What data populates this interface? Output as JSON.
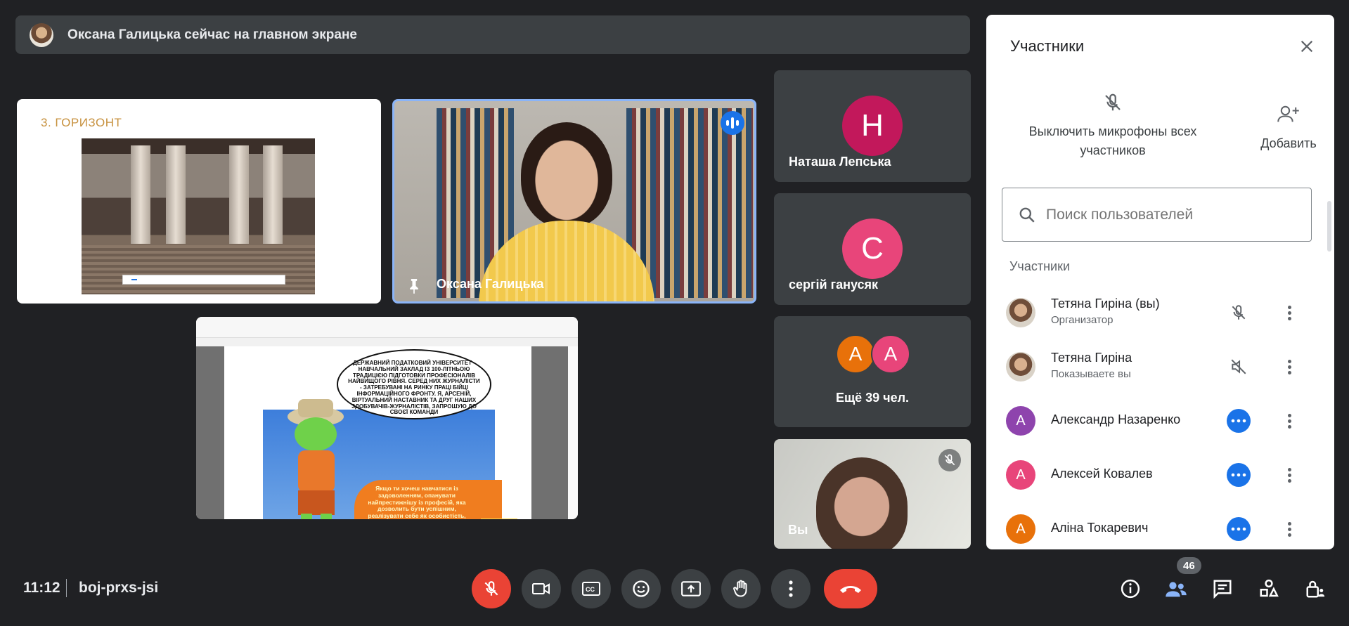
{
  "banner": {
    "text": "Оксана Галицька сейчас на главном экране"
  },
  "tiles": {
    "slide": {
      "title": "3. ГОРИЗОНТ",
      "bar_text": "",
      "bar_button": ""
    },
    "speaker": {
      "name": "Оксана Галицька"
    },
    "document": {
      "bubble_text": "ДЕРЖАВНИЙ ПОДАТКОВИЙ УНІВЕРСИТЕТ - НАВЧАЛЬНИЙ ЗАКЛАД ІЗ 100-ЛІТНЬОЮ ТРАДИЦІЄЮ ПІДГОТОВКИ ПРОФЕСІОНАЛІВ НАЙВИЩОГО РІВНЯ. СЕРЕД НИХ ЖУРНАЛІСТИ - ЗАТРЕБУВАНІ НА РИНКУ ПРАЦІ БІЙЦІ ІНФОРМАЦІЙНОГО ФРОНТУ. Я, АРСЕНІЙ, ВІРТУАЛЬНИЙ НАСТАВНИК ТА ДРУГ НАШИХ ЗДОБУВАЧІВ-ЖУРНАЛІСТІВ, ЗАПРОШУЮ ДО СВОЄЇ КОМАНДИ",
      "orange_text": "Якщо ти хочеш навчатися із задоволенням, опанувати найпрестижнішу із професій, яка дозволить бути успішним, реалізувати себе як особистість, заробляти і залишатися вільним, мобільним, фінансово незалежним - тобі до нашої команди!"
    },
    "participants": [
      {
        "name": "Наташа Лепська",
        "initial": "Н",
        "color": "#c2185b"
      },
      {
        "name": "сергій ганусяк",
        "initial": "С",
        "color": "#e8457a"
      }
    ],
    "more": {
      "label": "Ещё 39 чел.",
      "initials": [
        "А",
        "А"
      ],
      "colors": [
        "#e8710a",
        "#e8457a"
      ]
    },
    "self": {
      "name": "Вы"
    }
  },
  "panel": {
    "title": "Участники",
    "mute_all_label": "Выключить микрофоны всех участников",
    "add_label": "Добавить",
    "search_placeholder": "Поиск пользователей",
    "section_label": "Участники",
    "people": [
      {
        "name": "Тетяна Гиріна (вы)",
        "sub": "Организатор",
        "avatar": "photo",
        "status_icon": "mic-off-icon"
      },
      {
        "name": "Тетяна Гиріна",
        "sub": "Показываете вы",
        "avatar": "photo",
        "status_icon": "volume-off-icon"
      },
      {
        "name": "Александр Назаренко",
        "sub": "",
        "initial": "А",
        "color": "#8e44ad",
        "status_icon": "more-horizontal-icon"
      },
      {
        "name": "Алексей Ковалев",
        "sub": "",
        "initial": "А",
        "color": "#e8457a",
        "status_icon": "more-horizontal-icon"
      },
      {
        "name": "Аліна Токаревич",
        "sub": "",
        "initial": "А",
        "color": "#e8710a",
        "status_icon": "more-horizontal-icon"
      }
    ]
  },
  "bottom": {
    "time": "11:12",
    "meeting_code": "boj-prxs-jsi",
    "participant_count": "46"
  },
  "colors": {
    "accent": "#1a73e8",
    "danger": "#ea4335",
    "surface": "#3c4043",
    "background": "#202124"
  }
}
